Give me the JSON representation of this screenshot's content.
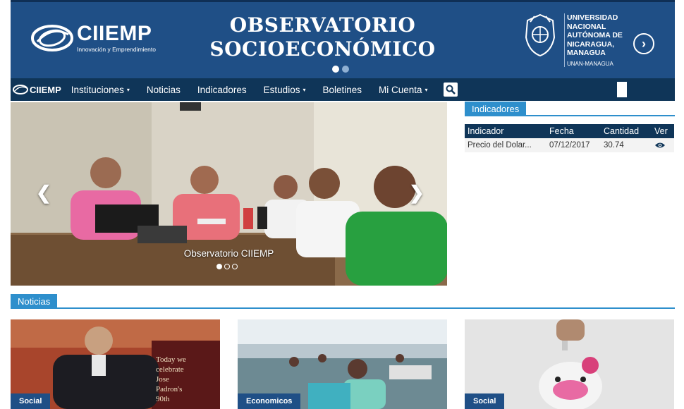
{
  "banner": {
    "brand_name": "CIIEMP",
    "brand_tagline": "Innovación y Emprendimiento",
    "title_line1": "OBSERVATORIO",
    "title_line2": "SOCIOECONÓMICO",
    "university": [
      "UNIVERSIDAD",
      "NACIONAL",
      "AUTÓNOMA DE",
      "NICARAGUA,",
      "MANAGUA"
    ],
    "university_abbr": "UNAN-MANAGUA",
    "next_icon": "chevron-right-circle-icon"
  },
  "nav": {
    "brand": "CIIEMP",
    "items": [
      "Instituciones",
      "Noticias",
      "Indicadores",
      "Estudios",
      "Boletines",
      "Mi Cuenta"
    ],
    "search_icon": "search-icon"
  },
  "carousel": {
    "caption": "Observatorio CIIEMP",
    "prev": "❮",
    "next": "❯"
  },
  "indicators": {
    "heading": "Indicadores",
    "columns": [
      "Indicador",
      "Fecha",
      "Cantidad",
      "Ver"
    ],
    "rows": [
      {
        "indicador": "Precio del Dolar...",
        "fecha": "07/12/2017",
        "cantidad": "30.74",
        "ver": "eye-icon"
      }
    ]
  },
  "news": {
    "heading": "Noticias",
    "cards": [
      {
        "category": "Social"
      },
      {
        "category": "Economicos"
      },
      {
        "category": "Social"
      }
    ]
  },
  "colors": {
    "banner_bg": "#1f4f86",
    "nav_bg": "#0f3558",
    "accent": "#2e8fcc"
  }
}
